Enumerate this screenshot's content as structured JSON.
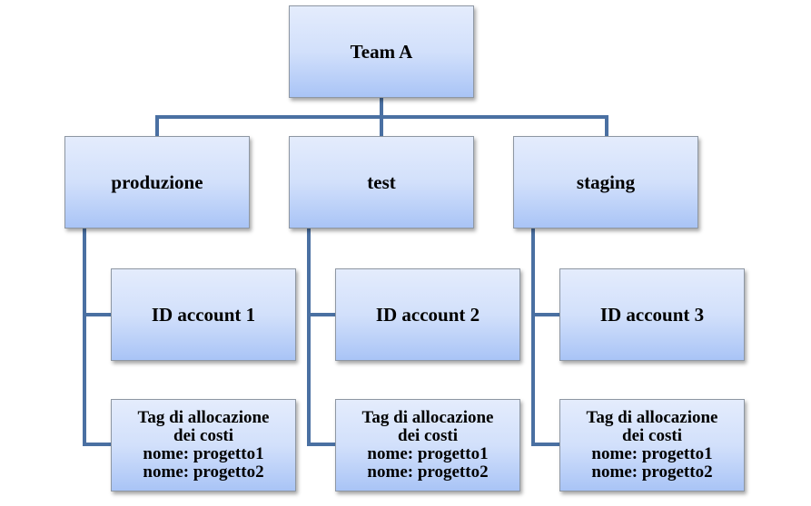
{
  "root": {
    "label": "Team A"
  },
  "environments": [
    {
      "label": "produzione",
      "account": "ID account 1",
      "tags": {
        "title_line1": "Tag di allocazione",
        "title_line2": "dei costi",
        "items": [
          "nome: progetto1",
          "nome: progetto2"
        ]
      }
    },
    {
      "label": "test",
      "account": "ID account 2",
      "tags": {
        "title_line1": "Tag di allocazione",
        "title_line2": "dei costi",
        "items": [
          "nome: progetto1",
          "nome: progetto2"
        ]
      }
    },
    {
      "label": "staging",
      "account": "ID account 3",
      "tags": {
        "title_line1": "Tag di allocazione",
        "title_line2": "dei costi",
        "items": [
          "nome: progetto1",
          "nome: progetto2"
        ]
      }
    }
  ],
  "colors": {
    "connector": "#4a70a2",
    "box_top": "#e4ecfc",
    "box_bottom": "#a9c4f6"
  }
}
